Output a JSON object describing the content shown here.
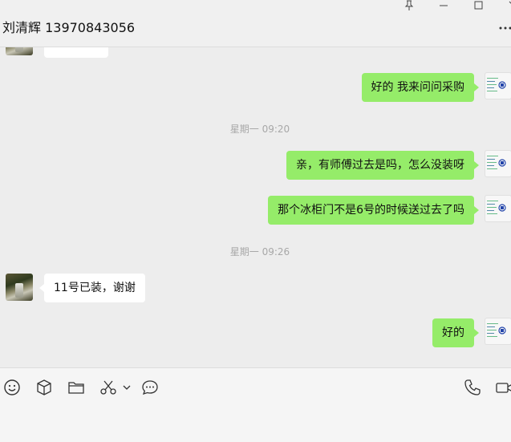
{
  "header": {
    "title": "刘清辉 13970843056"
  },
  "messages": [
    {
      "type": "text",
      "side": "other",
      "text": "..."
    },
    {
      "type": "text",
      "side": "me",
      "text": "好的 我来问问采购"
    },
    {
      "type": "time",
      "text": "星期一 09:20"
    },
    {
      "type": "text",
      "side": "me",
      "text": "亲，有师傅过去是吗，怎么没装呀"
    },
    {
      "type": "text",
      "side": "me",
      "text": "那个冰柜门不是6号的时候送过去了吗"
    },
    {
      "type": "time",
      "text": "星期一 09:26"
    },
    {
      "type": "text",
      "side": "other",
      "text": "11号已装，谢谢"
    },
    {
      "type": "text",
      "side": "me",
      "text": "好的"
    }
  ],
  "toolbar": {
    "icons": [
      "emoji-icon",
      "box-icon",
      "folder-icon",
      "scissors-icon",
      "chevron-down-icon",
      "chat-bubble-icon",
      "phone-icon",
      "video-icon"
    ]
  }
}
